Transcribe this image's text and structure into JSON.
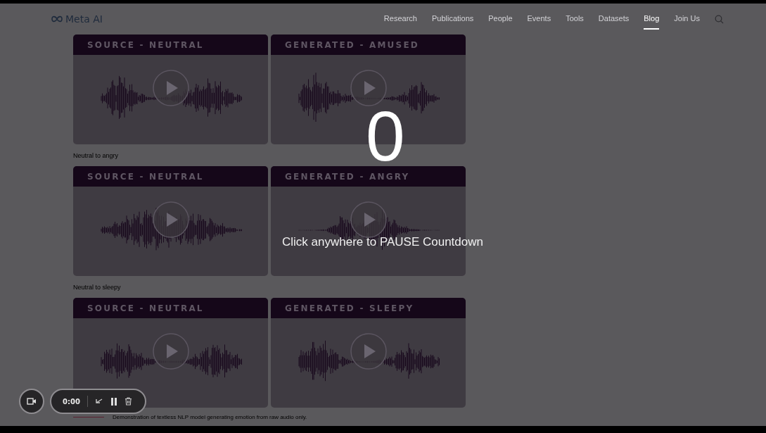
{
  "nav": {
    "logo": "Meta AI",
    "links": [
      {
        "label": "Research",
        "selected": false
      },
      {
        "label": "Publications",
        "selected": false
      },
      {
        "label": "People",
        "selected": false
      },
      {
        "label": "Events",
        "selected": false
      },
      {
        "label": "Tools",
        "selected": false
      },
      {
        "label": "Datasets",
        "selected": false
      },
      {
        "label": "Blog",
        "selected": true
      },
      {
        "label": "Join Us",
        "selected": false
      }
    ]
  },
  "groups": [
    {
      "cards": [
        {
          "title": "SOURCE - NEUTRAL"
        },
        {
          "title": "GENERATED - AMUSED"
        }
      ]
    },
    {
      "label": "Neutral to angry",
      "cards": [
        {
          "title": "SOURCE - NEUTRAL"
        },
        {
          "title": "GENERATED - ANGRY"
        }
      ]
    },
    {
      "label": "Neutral to sleepy",
      "cards": [
        {
          "title": "SOURCE - NEUTRAL"
        },
        {
          "title": "GENERATED - SLEEPY"
        }
      ]
    }
  ],
  "caption": "Demonstration of textless NLP model generating emotion from raw audio only.",
  "countdown": {
    "number": "0",
    "message": "Click anywhere to PAUSE Countdown"
  },
  "recorder": {
    "time": "0:00"
  }
}
